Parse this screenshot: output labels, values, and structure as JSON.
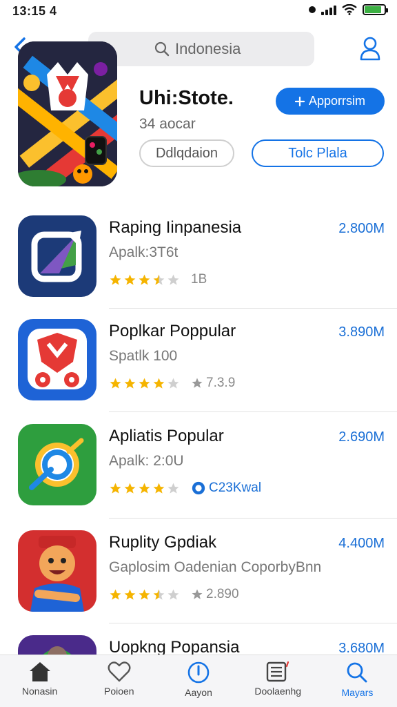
{
  "status": {
    "time": "13:15 4"
  },
  "search": {
    "text": "Indonesia"
  },
  "hero": {
    "title": "Uhi:Stote.",
    "subtitle": "34 aocar",
    "primary_button": "Apporrsim",
    "secondary_button": "Ddlqdaion",
    "tertiary_button": "Tolc Plala"
  },
  "apps": [
    {
      "name": "Raping Iinpanesia",
      "sub": "Apalk:3T6t",
      "size": "2.800M",
      "rating_note": "1B",
      "stars": 3.5
    },
    {
      "name": "Poplkar Poppular",
      "sub": "Spatlk 100",
      "size": "3.890M",
      "rating_note": "7.3.9",
      "stars": 4
    },
    {
      "name": "Apliatis Popular",
      "sub": "Apalk: 2:0U",
      "size": "2.690M",
      "rating_note": "C23Kwal",
      "stars": 4
    },
    {
      "name": "Ruplity Gpdiak",
      "sub": "Gaplosim Oadenian CoporbyBnn",
      "size": "4.400M",
      "rating_note": "2.890",
      "stars": 3.5
    },
    {
      "name": "Uopkng Popansia",
      "size": "3.680M"
    }
  ],
  "tabs": [
    {
      "label": "Nonasin",
      "icon": "home-icon"
    },
    {
      "label": "Poioen",
      "icon": "heart-icon"
    },
    {
      "label": "Aayon",
      "icon": "info-icon"
    },
    {
      "label": "Doolaenhg",
      "icon": "news-icon"
    },
    {
      "label": "Mayars",
      "icon": "search-icon"
    }
  ],
  "colors": {
    "accent": "#1473e6",
    "star": "#f5b400",
    "star_empty": "#cfcfcf"
  }
}
